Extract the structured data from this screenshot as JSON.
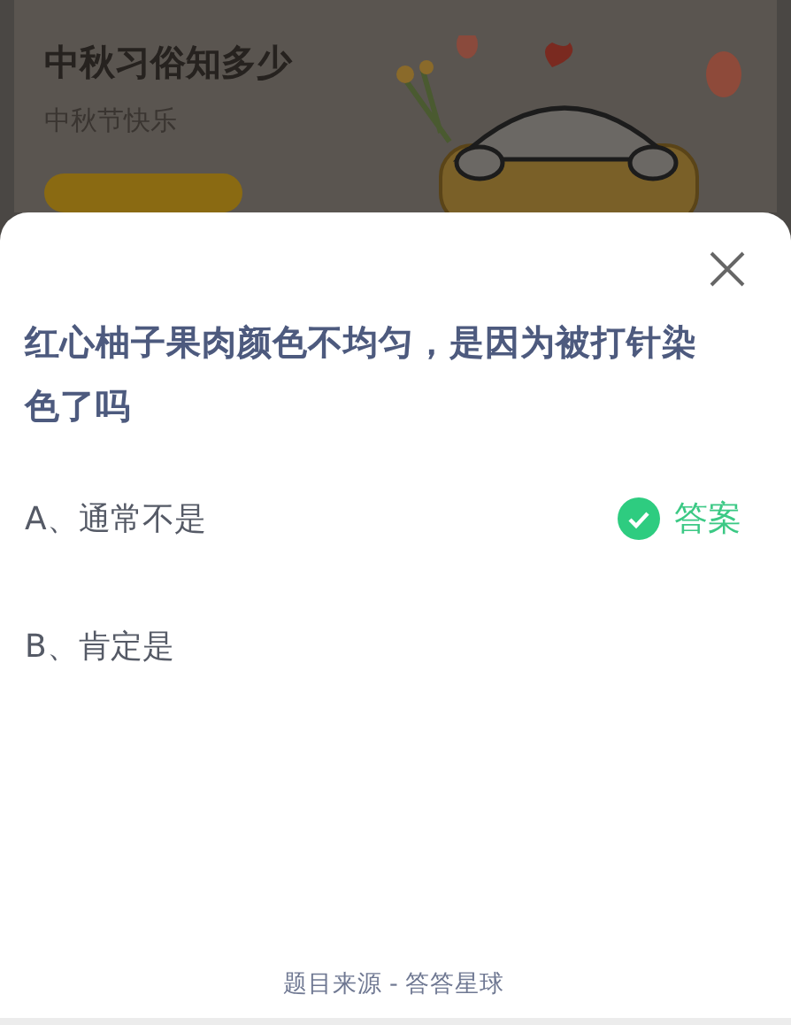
{
  "banner": {
    "title": "中秋习俗知多少",
    "subtitle": "中秋节快乐"
  },
  "quiz": {
    "question": "红心柚子果肉颜色不均匀，是因为被打针染色了吗",
    "options": [
      {
        "label": "A、通常不是",
        "correct": true
      },
      {
        "label": "B、肯定是",
        "correct": false
      }
    ],
    "answer_label": "答案"
  },
  "footer": "题目来源 - 答答星球"
}
